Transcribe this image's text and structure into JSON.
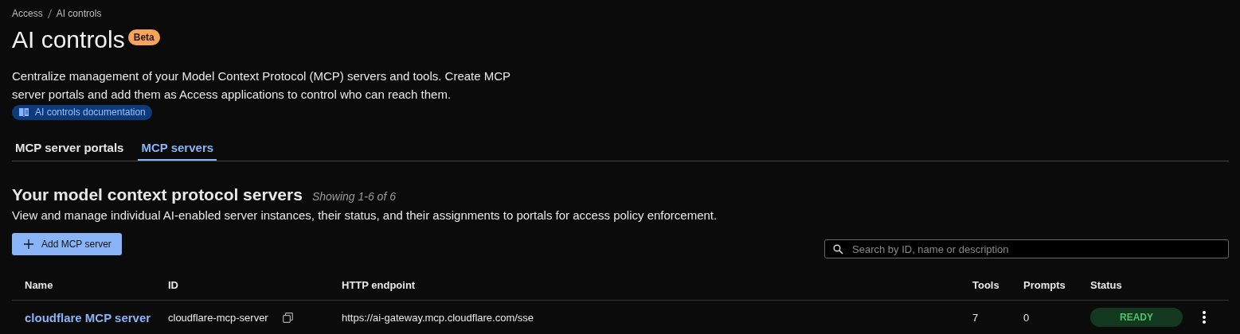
{
  "breadcrumb": [
    "Access",
    "AI controls"
  ],
  "title": "AI controls",
  "badge": "Beta",
  "description": "Centralize management of your Model Context Protocol (MCP) servers and tools. Create MCP server portals and add them as Access applications to control who can reach them.",
  "doc_link": "AI controls documentation",
  "tabs": [
    {
      "label": "MCP server portals",
      "selected": false
    },
    {
      "label": "MCP servers",
      "selected": true
    }
  ],
  "section": {
    "title": "Your model context protocol servers",
    "count": "Showing 1-6 of 6",
    "subtitle": "View and manage individual AI-enabled server instances, their status, and their assignments to portals for access policy enforcement."
  },
  "add_button": "Add MCP server",
  "search": {
    "placeholder": "Search by ID, name or description"
  },
  "table": {
    "columns": [
      "Name",
      "ID",
      "HTTP endpoint",
      "Tools",
      "Prompts",
      "Status"
    ],
    "rows": [
      {
        "name": "cloudflare MCP server",
        "id": "cloudflare-mcp-server",
        "endpoint": "https://ai-gateway.mcp.cloudflare.com/sse",
        "tools": "7",
        "prompts": "0",
        "status": {
          "label": "READY",
          "kind": "ready"
        }
      }
    ]
  }
}
